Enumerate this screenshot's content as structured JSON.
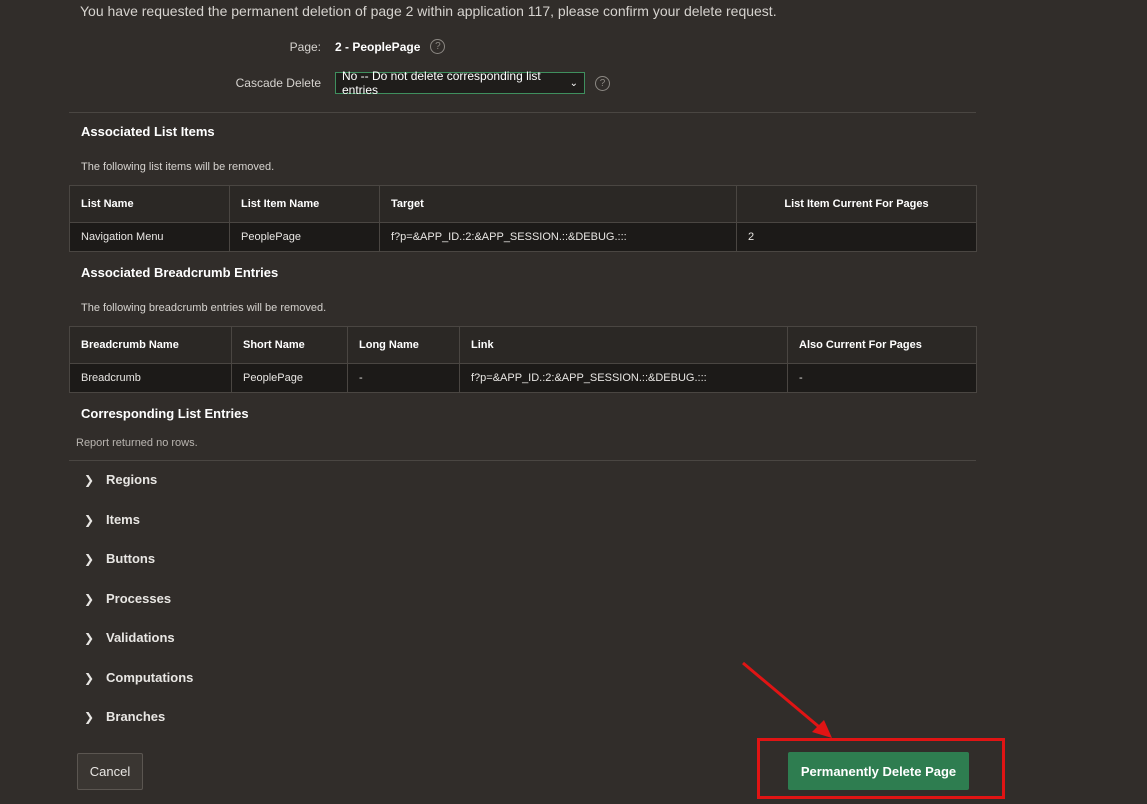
{
  "intro_text": "You have requested the permanent deletion of page 2 within application 117, please confirm your delete request.",
  "form": {
    "page_label": "Page:",
    "page_value": "2 - PeoplePage",
    "cascade_label": "Cascade Delete",
    "cascade_value": "No -- Do not delete corresponding list entries"
  },
  "list_items": {
    "title": "Associated List Items",
    "description": "The following list items will be removed.",
    "columns": [
      "List Name",
      "List Item Name",
      "Target",
      "List Item Current For Pages"
    ],
    "rows": [
      [
        "Navigation Menu",
        "PeoplePage",
        "f?p=&APP_ID.:2:&APP_SESSION.::&DEBUG.:::",
        "2"
      ]
    ]
  },
  "breadcrumbs": {
    "title": "Associated Breadcrumb Entries",
    "description": "The following breadcrumb entries will be removed.",
    "columns": [
      "Breadcrumb Name",
      "Short Name",
      "Long Name",
      "Link",
      "Also Current For Pages"
    ],
    "rows": [
      [
        "Breadcrumb",
        "PeoplePage",
        "-",
        "f?p=&APP_ID.:2:&APP_SESSION.::&DEBUG.:::",
        "-"
      ]
    ]
  },
  "list_entries": {
    "title": "Corresponding List Entries",
    "empty_text": "Report returned no rows."
  },
  "collapsibles": [
    "Regions",
    "Items",
    "Buttons",
    "Processes",
    "Validations",
    "Computations",
    "Branches"
  ],
  "buttons": {
    "cancel": "Cancel",
    "delete": "Permanently Delete Page"
  },
  "icons": {
    "help": "help-icon",
    "chevron": "chevron-down-icon",
    "caret": "chevron-right-icon"
  },
  "colors": {
    "background": "#312d2a",
    "primary_button": "#2e7d50",
    "annotation": "#e01414"
  }
}
